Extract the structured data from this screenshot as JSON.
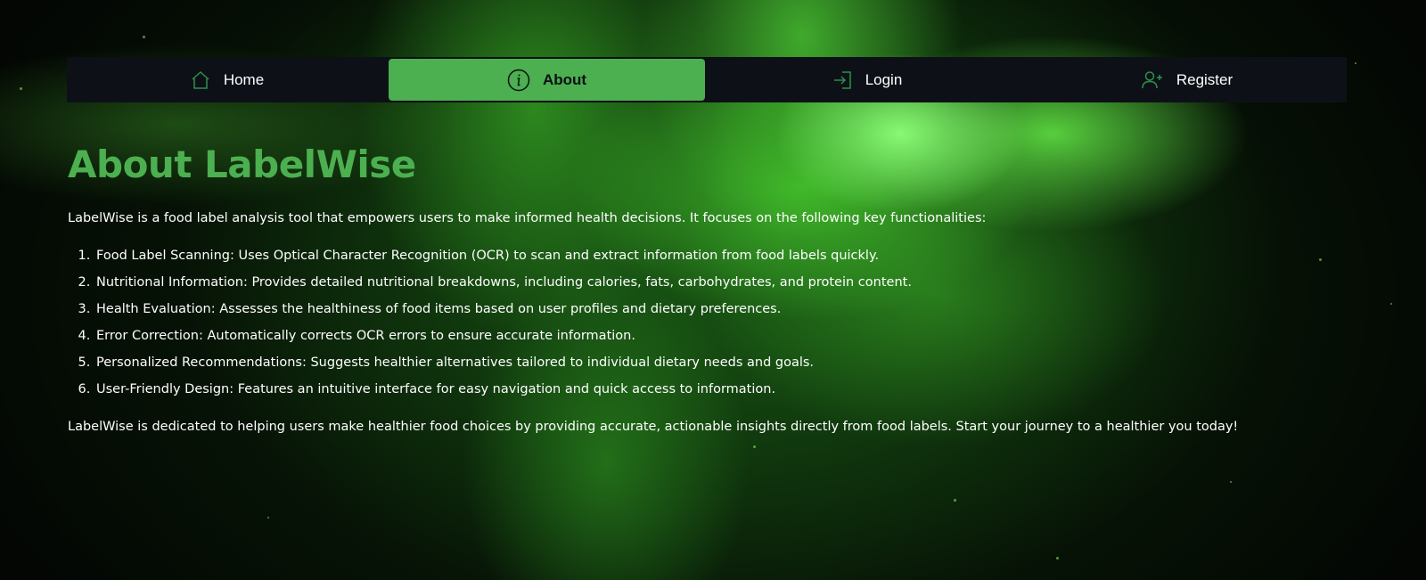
{
  "nav": {
    "items": [
      {
        "label": "Home",
        "icon": "home-icon",
        "active": false
      },
      {
        "label": "About",
        "icon": "info-icon",
        "active": true
      },
      {
        "label": "Login",
        "icon": "login-icon",
        "active": false
      },
      {
        "label": "Register",
        "icon": "user-plus-icon",
        "active": false
      }
    ]
  },
  "main": {
    "title": "About LabelWise",
    "intro": "LabelWise is a food label analysis tool that empowers users to make informed health decisions. It focuses on the following key functionalities:",
    "features": [
      "Food Label Scanning: Uses Optical Character Recognition (OCR) to scan and extract information from food labels quickly.",
      "Nutritional Information: Provides detailed nutritional breakdowns, including calories, fats, carbohydrates, and protein content.",
      "Health Evaluation: Assesses the healthiness of food items based on user profiles and dietary preferences.",
      "Error Correction: Automatically corrects OCR errors to ensure accurate information.",
      "Personalized Recommendations: Suggests healthier alternatives tailored to individual dietary needs and goals.",
      "User-Friendly Design: Features an intuitive interface for easy navigation and quick access to information."
    ],
    "outro": "LabelWise is dedicated to helping users make healthier food choices by providing accurate, actionable insights directly from food labels. Start your journey to a healthier you today!"
  },
  "colors": {
    "accent": "#4caf50",
    "nav_background": "#0d1117",
    "text": "#ffffff"
  }
}
